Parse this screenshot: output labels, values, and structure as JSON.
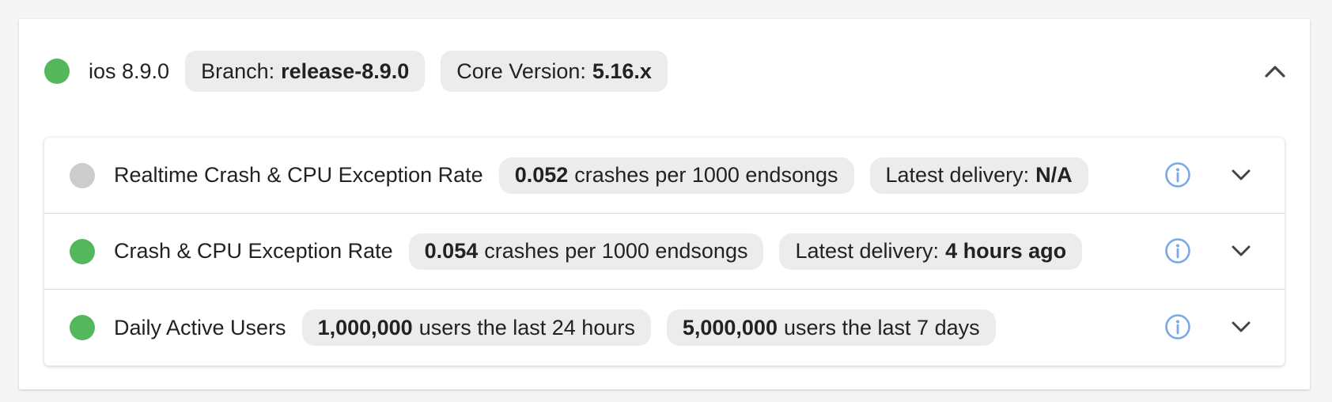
{
  "colors": {
    "status_green": "#55b75b",
    "status_grey": "#cccccc",
    "info_blue": "#7aa7e6",
    "chip_bg": "#ececec"
  },
  "release": {
    "status": "green",
    "name": "ios 8.9.0",
    "branch_label": "Branch:",
    "branch_value": "release-8.9.0",
    "core_label": "Core Version:",
    "core_value": "5.16.x",
    "collapse_icon": "chevron-up-icon"
  },
  "metrics": [
    {
      "status": "grey",
      "name": "Realtime Crash & CPU Exception Rate",
      "value": "0.052",
      "value_suffix": "crashes per 1000 endsongs",
      "secondary_label": "Latest delivery:",
      "secondary_value": "N/A",
      "info_icon": "info-icon",
      "expand_icon": "chevron-down-icon"
    },
    {
      "status": "green",
      "name": "Crash & CPU Exception Rate",
      "value": "0.054",
      "value_suffix": "crashes per 1000 endsongs",
      "secondary_label": "Latest delivery:",
      "secondary_value": "4 hours ago",
      "info_icon": "info-icon",
      "expand_icon": "chevron-down-icon"
    },
    {
      "status": "green",
      "name": "Daily Active Users",
      "value": "1,000,000",
      "value_suffix": "users the last 24 hours",
      "secondary_value": "5,000,000",
      "secondary_suffix": "users the last 7 days",
      "info_icon": "info-icon",
      "expand_icon": "chevron-down-icon"
    }
  ]
}
